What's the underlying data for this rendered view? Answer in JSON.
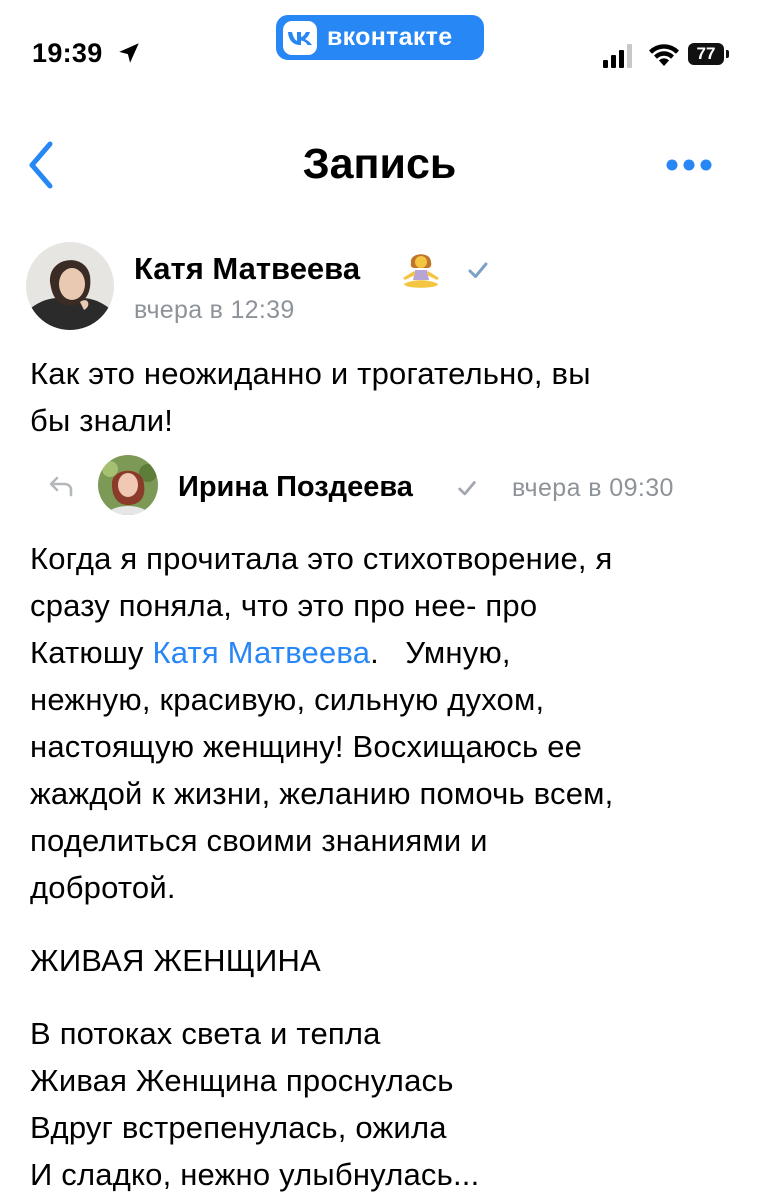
{
  "status_bar": {
    "time": "19:39",
    "app_pill": "вконтакте",
    "battery": "77"
  },
  "nav": {
    "title": "Запись"
  },
  "post": {
    "author": "Катя Матвеева",
    "author_emoji": "🧘‍♀️",
    "time": "вчера в 12:39",
    "text_lines": [
      "Как это неожиданно и трогательно, вы",
      "бы знали!"
    ]
  },
  "repost": {
    "author": "Ирина Поздеева",
    "time": "вчера в 09:30",
    "body": {
      "p1_line1": "Когда я прочитала это стихотворение, я",
      "p1_line2": "сразу поняла, что это про нее- про",
      "p1_line3_before": "Катюшу ",
      "mention": "Катя Матвеева",
      "p1_line3_after": ".   Умную,",
      "p1_line4": "нежную, красивую, сильную духом,",
      "p1_line5": "настоящую женщину! Восхищаюсь ее",
      "p1_line6": "жаждой к жизни, желанию помочь всем,",
      "p1_line7": "поделиться своими знаниями и",
      "p1_line8": "добротой.",
      "poem_title": "ЖИВАЯ ЖЕНЩИНА",
      "poem_lines": [
        "В потоках света и тепла",
        "Живая Женщина проснулась",
        "Вдруг встрепенулась, ожила",
        "И сладко, нежно улыбнулась..."
      ]
    }
  },
  "colors": {
    "accent": "#2787f5",
    "secondary_text": "#8e9399",
    "verified": "#8e9399"
  }
}
